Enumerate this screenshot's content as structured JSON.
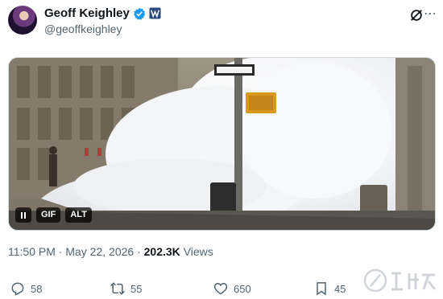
{
  "author": {
    "name": "Geoff Keighley",
    "handle": "@geoffkeighley"
  },
  "media": {
    "gif_label": "GIF",
    "alt_label": "ALT"
  },
  "meta": {
    "time": "11:50 PM",
    "separator": "·",
    "date": "May 22, 2026",
    "separator2": "·",
    "views_count": "202.3K",
    "views_label": "Views"
  },
  "actions": {
    "replies": "58",
    "reposts": "55",
    "likes": "650",
    "bookmarks": "45"
  },
  "colors": {
    "text": "#0f1419",
    "muted": "#536471",
    "verified": "#1d9bf0"
  },
  "icons": [
    "verified-badge-icon",
    "affiliate-badge-icon",
    "grok-icon",
    "more-icon",
    "pause-icon",
    "reply-icon",
    "repost-icon",
    "like-icon",
    "bookmark-icon"
  ]
}
